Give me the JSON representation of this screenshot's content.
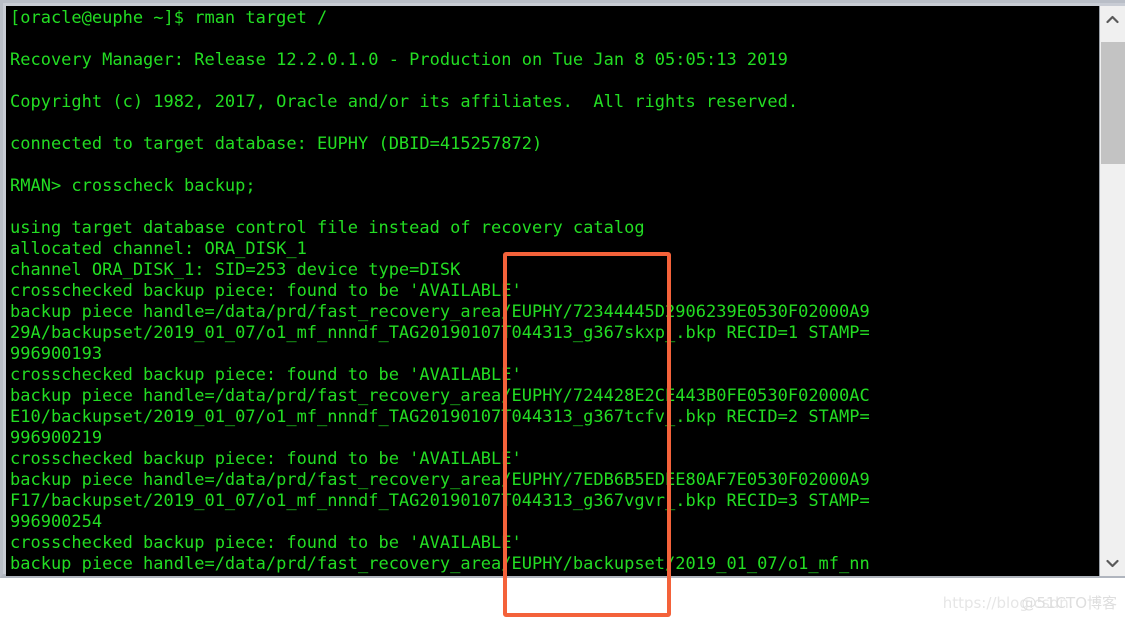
{
  "window": {
    "type": "terminal",
    "background_color": "#000000",
    "text_color": "#23dd23",
    "frame_color": "#c8ccd4"
  },
  "scrollbar": {
    "up_arrow_label": "scroll up",
    "down_arrow_label": "scroll down",
    "thumb_label": "scroll thumb"
  },
  "annotation": {
    "color": "#f4623a",
    "shape": "rectangle"
  },
  "watermark": {
    "url": "https://blog.csdn.",
    "handle": "@51CTO博客"
  },
  "terminal": {
    "prompt": "[oracle@euphe ~]$ rman target /",
    "lines": [
      "[oracle@euphe ~]$ rman target /",
      "",
      "Recovery Manager: Release 12.2.0.1.0 - Production on Tue Jan 8 05:05:13 2019",
      "",
      "Copyright (c) 1982, 2017, Oracle and/or its affiliates.  All rights reserved.",
      "",
      "connected to target database: EUPHY (DBID=415257872)",
      "",
      "RMAN> crosscheck backup;",
      "",
      "using target database control file instead of recovery catalog",
      "allocated channel: ORA_DISK_1",
      "channel ORA_DISK_1: SID=253 device type=DISK",
      "crosschecked backup piece: found to be 'AVAILABLE'",
      "backup piece handle=/data/prd/fast_recovery_area/EUPHY/72344445D2906239E0530F02000A9",
      "29A/backupset/2019_01_07/o1_mf_nnndf_TAG20190107T044313_g367skxp_.bkp RECID=1 STAMP=",
      "996900193",
      "crosschecked backup piece: found to be 'AVAILABLE'",
      "backup piece handle=/data/prd/fast_recovery_area/EUPHY/724428E2CE443B0FE0530F02000AC",
      "E10/backupset/2019_01_07/o1_mf_nnndf_TAG20190107T044313_g367tcfv_.bkp RECID=2 STAMP=",
      "996900219",
      "crosschecked backup piece: found to be 'AVAILABLE'",
      "backup piece handle=/data/prd/fast_recovery_area/EUPHY/7EDB6B5EDEE80AF7E0530F02000A9",
      "F17/backupset/2019_01_07/o1_mf_nnndf_TAG20190107T044313_g367vgvr_.bkp RECID=3 STAMP=",
      "996900254",
      "crosschecked backup piece: found to be 'AVAILABLE'",
      "backup piece handle=/data/prd/fast_recovery_area/EUPHY/backupset/2019_01_07/o1_mf_nn"
    ]
  }
}
